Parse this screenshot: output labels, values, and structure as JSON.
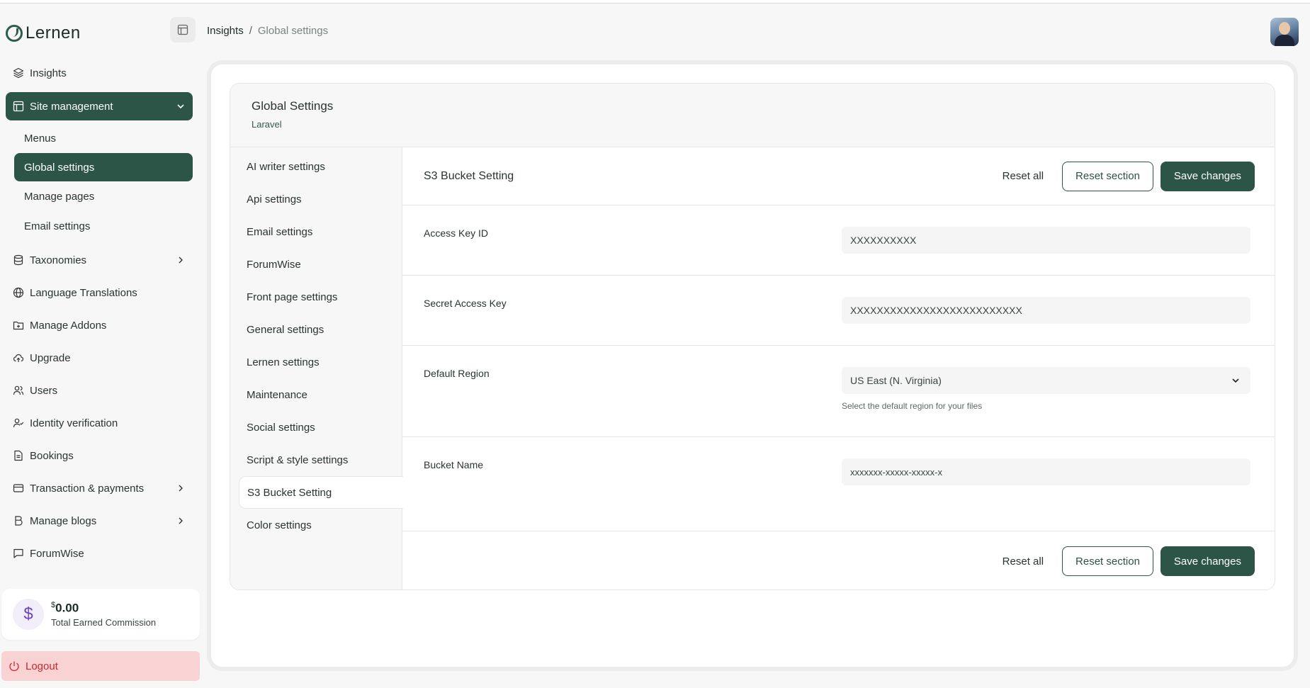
{
  "app": {
    "name": "Lernen"
  },
  "breadcrumb": {
    "root": "Insights",
    "separator": "/",
    "current": "Global settings"
  },
  "sidebar": {
    "items": [
      {
        "label": "Insights",
        "icon": "layers-icon"
      },
      {
        "label": "Site management",
        "icon": "layout-icon"
      },
      {
        "label": "Taxonomies",
        "icon": "database-icon"
      },
      {
        "label": "Language Translations",
        "icon": "globe-icon"
      },
      {
        "label": "Manage Addons",
        "icon": "folder-plus-icon"
      },
      {
        "label": "Upgrade",
        "icon": "cloud-upload-icon"
      },
      {
        "label": "Users",
        "icon": "users-icon"
      },
      {
        "label": "Identity verification",
        "icon": "user-check-icon"
      },
      {
        "label": "Bookings",
        "icon": "file-icon"
      },
      {
        "label": "Transaction & payments",
        "icon": "credit-card-icon"
      },
      {
        "label": "Manage blogs",
        "icon": "bold-b-icon"
      },
      {
        "label": "ForumWise",
        "icon": "message-square-icon"
      }
    ],
    "site_management_sub": [
      {
        "label": "Menus"
      },
      {
        "label": "Global settings"
      },
      {
        "label": "Manage pages"
      },
      {
        "label": "Email settings"
      }
    ],
    "commission": {
      "currency": "$",
      "amount": "0.00",
      "label": "Total Earned Commission"
    },
    "logout_label": "Logout"
  },
  "card": {
    "title": "Global Settings",
    "subtitle": "Laravel"
  },
  "tabs": [
    "AI writer settings",
    "Api settings",
    "Email settings",
    "ForumWise",
    "Front page settings",
    "General settings",
    "Lernen settings",
    "Maintenance",
    "Social settings",
    "Script & style settings",
    "S3 Bucket Setting",
    "Color settings"
  ],
  "section": {
    "title": "S3 Bucket Setting",
    "reset_all": "Reset all",
    "reset_section": "Reset section",
    "save_changes": "Save changes"
  },
  "fields": {
    "access_key": {
      "label": "Access Key ID",
      "value": "XXXXXXXXXX"
    },
    "secret_key": {
      "label": "Secret Access Key",
      "value": "XXXXXXXXXXXXXXXXXXXXXXXXXX"
    },
    "region": {
      "label": "Default Region",
      "value": "US East (N. Virginia)",
      "hint": "Select the default region for your files"
    },
    "bucket": {
      "label": "Bucket Name",
      "value": "xxxxxxx-xxxxx-xxxxx-x"
    }
  },
  "colors": {
    "primary": "#2c5447",
    "logout_bg": "#f9d2d3",
    "logout_text": "#d2262c"
  }
}
